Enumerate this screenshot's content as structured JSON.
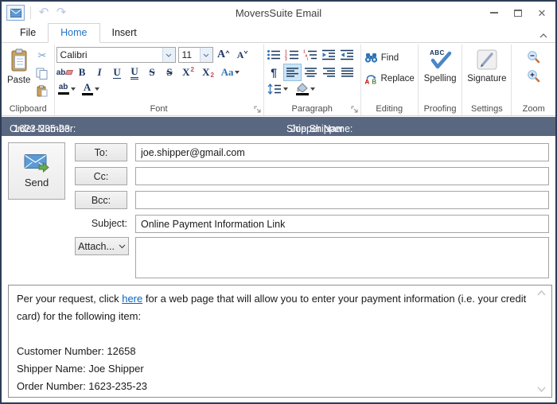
{
  "window": {
    "title": "MoversSuite Email"
  },
  "icons": {
    "undo": "↶",
    "redo": "↷",
    "cut": "✂",
    "close": "✕"
  },
  "tabs": {
    "file": "File",
    "home": "Home",
    "insert": "Insert"
  },
  "ribbon": {
    "clipboard": {
      "label": "Clipboard",
      "paste": "Paste"
    },
    "font": {
      "label": "Font",
      "name": "Calibri",
      "size": "11",
      "grow": "A",
      "shrink": "A",
      "clear": "ab",
      "bold": "B",
      "italic": "I",
      "underline": "U",
      "double_underline": "U",
      "strike": "S",
      "double_strike": "S",
      "sup_base": "X",
      "sup_mark": "2",
      "sub_base": "X",
      "sub_mark": "2",
      "change_case": "Aa",
      "highlight": "ab",
      "font_color": "A"
    },
    "paragraph": {
      "label": "Paragraph",
      "marks": "¶"
    },
    "editing": {
      "label": "Editing",
      "find": "Find",
      "replace": "Replace",
      "replace_a": "A",
      "replace_b": "B"
    },
    "proofing": {
      "label": "Proofing",
      "spelling": "Spelling",
      "abc": "ABC"
    },
    "settings": {
      "label": "Settings",
      "signature": "Signature"
    },
    "zoom": {
      "label": "Zoom"
    }
  },
  "info_bar": {
    "order_label": "Order Number:",
    "order_value": "1623-235-23",
    "shipper_label": "Shipper Name:",
    "shipper_value": "Joe Shipper"
  },
  "compose": {
    "send_label": "Send",
    "to_label": "To:",
    "to_value": "joe.shipper@gmail.com",
    "cc_label": "Cc:",
    "cc_value": "",
    "bcc_label": "Bcc:",
    "bcc_value": "",
    "subject_label": "Subject:",
    "subject_value": "Online Payment Information Link",
    "attach_label": "Attach..."
  },
  "body": {
    "para_pre": "Per your request, click ",
    "link_text": "here",
    "para_post": " for a web page that will allow you to enter your payment information (i.e. your credit card) for the following item:",
    "customer_line": "Customer Number: 12658",
    "shipper_line": "Shipper Name: Joe Shipper",
    "order_line": "Order Number: 1623-235-23"
  },
  "colors": {
    "accent": "#2473c8",
    "info_bar": "#5a6780",
    "link": "#0563c1",
    "selected": "#cde4f7"
  }
}
